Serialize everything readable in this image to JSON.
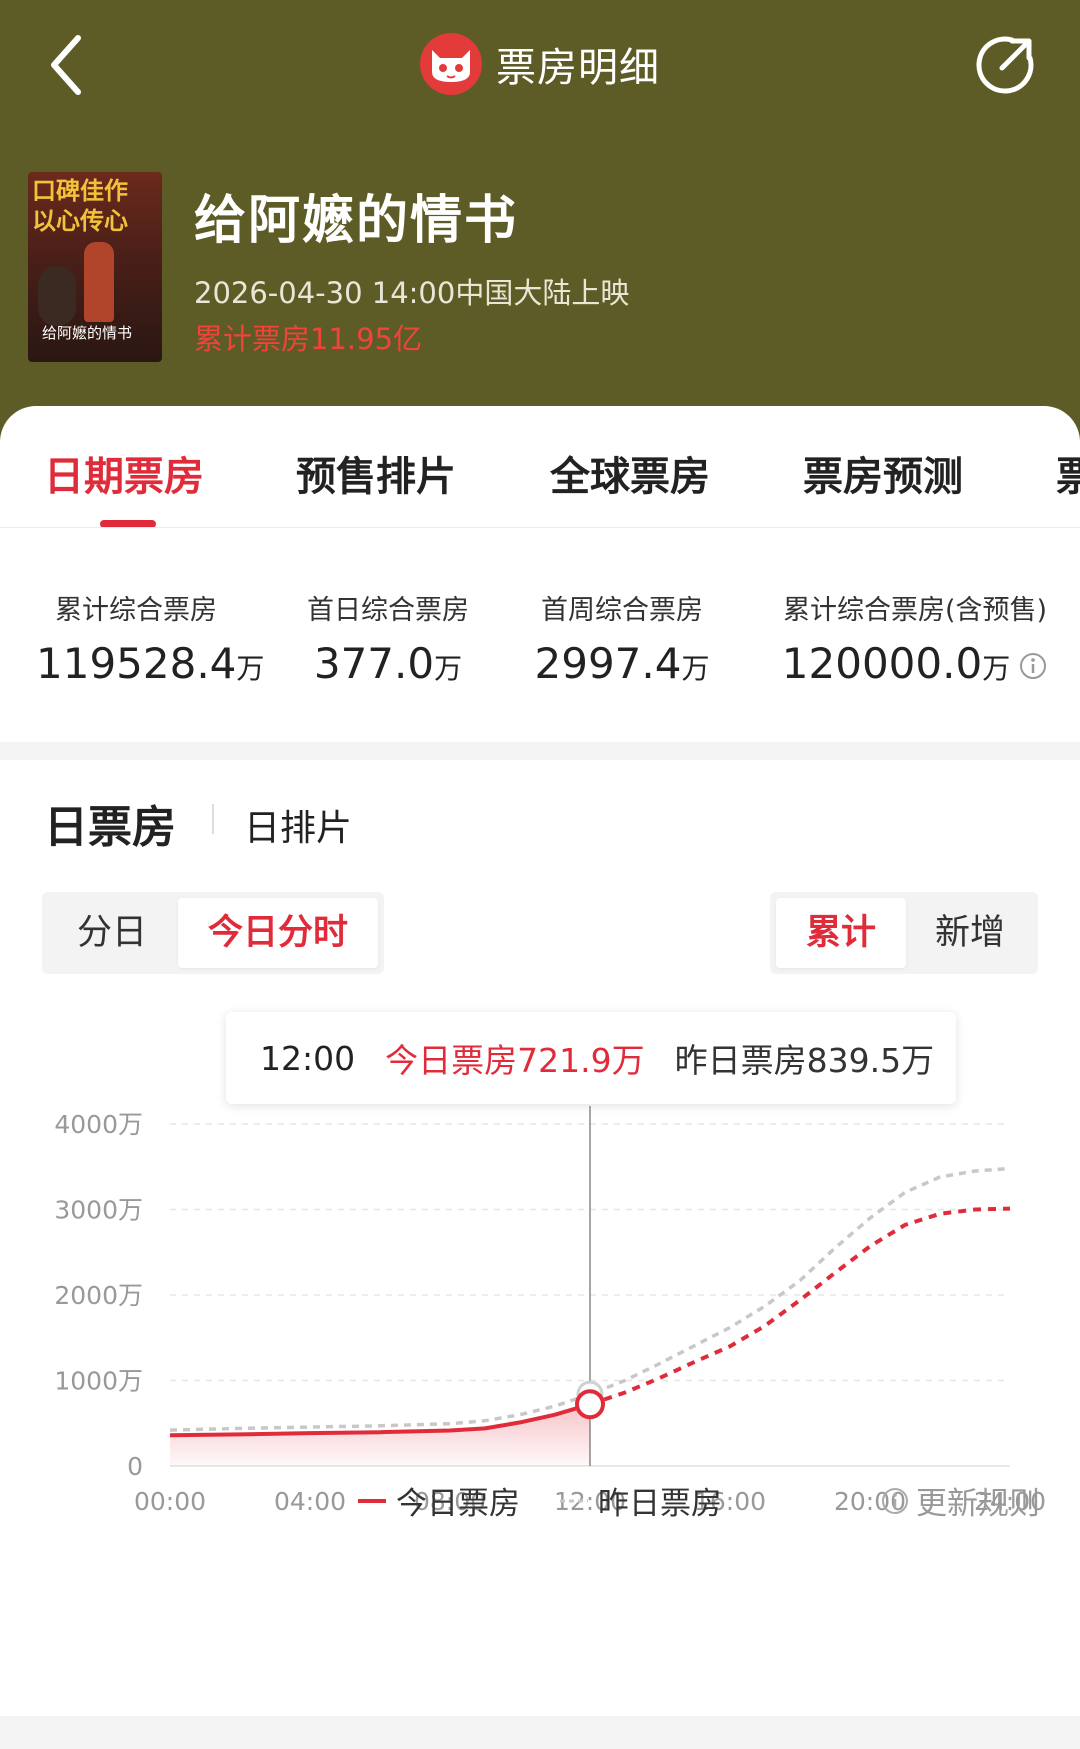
{
  "nav": {
    "title": "票房明细",
    "back_icon": "chevron-left-icon",
    "share_icon": "share-icon",
    "logo_icon": "cat-logo-icon"
  },
  "movie": {
    "title": "给阿嬷的情书",
    "release": "2026-04-30 14:00中国大陆上映",
    "total": "累计票房11.95亿",
    "poster_tag_line1": "口碑佳作",
    "poster_tag_line2": "以心传心",
    "poster_title": "给阿嬷的情书"
  },
  "tabs": [
    {
      "label": "日期票房",
      "active": true
    },
    {
      "label": "预售排片",
      "active": false
    },
    {
      "label": "全球票房",
      "active": false
    },
    {
      "label": "票房预测",
      "active": false
    },
    {
      "label": "票",
      "active": false
    }
  ],
  "stats": [
    {
      "label": "累计综合票房",
      "value": "119528.4",
      "unit": "万"
    },
    {
      "label": "首日综合票房",
      "value": "377.0",
      "unit": "万"
    },
    {
      "label": "首周综合票房",
      "value": "2997.4",
      "unit": "万"
    },
    {
      "label": "累计综合票房(含预售)",
      "value": "120000.0",
      "unit": "万"
    }
  ],
  "section": {
    "title": "日票房",
    "subtitle": "日排片"
  },
  "mode_toggle": {
    "options": [
      "分日",
      "今日分时"
    ],
    "selected": "今日分时"
  },
  "value_toggle": {
    "options": [
      "累计",
      "新增"
    ],
    "selected": "累计"
  },
  "tooltip": {
    "time": "12:00",
    "today": "今日票房721.9万",
    "yesterday": "昨日票房839.5万"
  },
  "legend": {
    "today": "今日票房",
    "yesterday": "昨日票房",
    "update_rule": "更新规则"
  },
  "colors": {
    "accent": "#e02c3a",
    "header_bg": "#5e5c26",
    "yesterday_line": "#c8c8c8"
  },
  "chart_data": {
    "type": "line",
    "x_ticks": [
      "00:00",
      "04:00",
      "08:00",
      "12:00",
      "16:00",
      "20:00",
      "24:00"
    ],
    "y_ticks": [
      "0",
      "1000万",
      "2000万",
      "3000万",
      "4000万"
    ],
    "ylim": [
      0,
      4000
    ],
    "grid": true,
    "marker_x": 12,
    "series": [
      {
        "name": "今日票房",
        "style": "solid-then-dashed",
        "points": [
          [
            0,
            360
          ],
          [
            2,
            370
          ],
          [
            4,
            385
          ],
          [
            6,
            395
          ],
          [
            8,
            415
          ],
          [
            9,
            440
          ],
          [
            10,
            510
          ],
          [
            11,
            600
          ],
          [
            12,
            722
          ],
          [
            13,
            860
          ],
          [
            14,
            1030
          ],
          [
            15,
            1220
          ],
          [
            16,
            1400
          ],
          [
            17,
            1640
          ],
          [
            18,
            1940
          ],
          [
            19,
            2260
          ],
          [
            20,
            2570
          ],
          [
            21,
            2820
          ],
          [
            22,
            2950
          ],
          [
            23,
            3000
          ],
          [
            24,
            3010
          ]
        ]
      },
      {
        "name": "昨日票房",
        "style": "dashed",
        "points": [
          [
            0,
            420
          ],
          [
            2,
            440
          ],
          [
            4,
            455
          ],
          [
            6,
            470
          ],
          [
            8,
            495
          ],
          [
            9,
            530
          ],
          [
            10,
            600
          ],
          [
            11,
            700
          ],
          [
            12,
            840
          ],
          [
            13,
            1000
          ],
          [
            14,
            1200
          ],
          [
            15,
            1410
          ],
          [
            16,
            1620
          ],
          [
            17,
            1870
          ],
          [
            18,
            2170
          ],
          [
            19,
            2550
          ],
          [
            20,
            2900
          ],
          [
            21,
            3200
          ],
          [
            22,
            3380
          ],
          [
            23,
            3450
          ],
          [
            24,
            3480
          ]
        ]
      }
    ]
  }
}
